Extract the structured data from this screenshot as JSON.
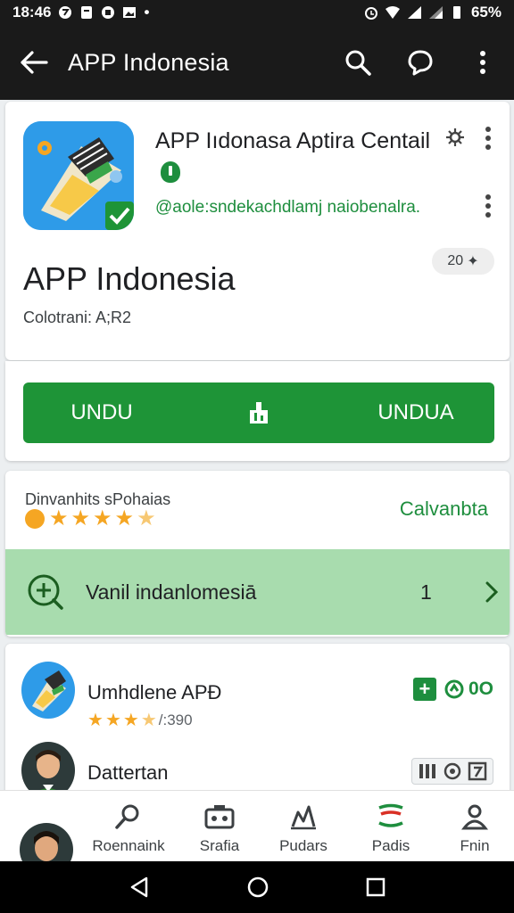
{
  "status_bar": {
    "time": "18:46",
    "battery": "65%"
  },
  "app_bar": {
    "title": "APP Indonesia",
    "back_icon": "arrow-back-icon",
    "search_icon": "search-icon",
    "chat_icon": "chat-bubble-icon",
    "more_icon": "more-vert-icon"
  },
  "app_header": {
    "name": "APP Iıdonasa Aptira Centail",
    "handle": "@aole:sndekachdlamj naiobenalra.",
    "big_title": "APP Indonesia",
    "category": "Colotrani: A;R2",
    "chip_value": "20"
  },
  "download": {
    "left_label": "UNDU",
    "right_label": "UNDUA"
  },
  "rating": {
    "label": "Dinvanhits sPohaias",
    "stars": 4.5,
    "link": "Calvanbta"
  },
  "promo": {
    "text": "Vanil indanlomesiā",
    "count": "1"
  },
  "list": [
    {
      "title": "Umhdlene APÐ",
      "rating": 3.5,
      "count": "/:390",
      "badge_value": "0O"
    },
    {
      "title": "Dattertan"
    }
  ],
  "bottom_nav": {
    "items": [
      {
        "label": "Roennaink",
        "icon": "search-icon"
      },
      {
        "label": "Srafia",
        "icon": "camera-icon"
      },
      {
        "label": "Pudars",
        "icon": "chart-icon"
      },
      {
        "label": "Padis",
        "icon": "flag-icon"
      },
      {
        "label": "Fnin",
        "icon": "person-icon"
      }
    ]
  },
  "colors": {
    "accent_green": "#1e9437",
    "link_green": "#1e8e3e",
    "promo_bg": "#a8dcae",
    "star": "#f5a623",
    "bar_bg": "#1a1a1a"
  }
}
